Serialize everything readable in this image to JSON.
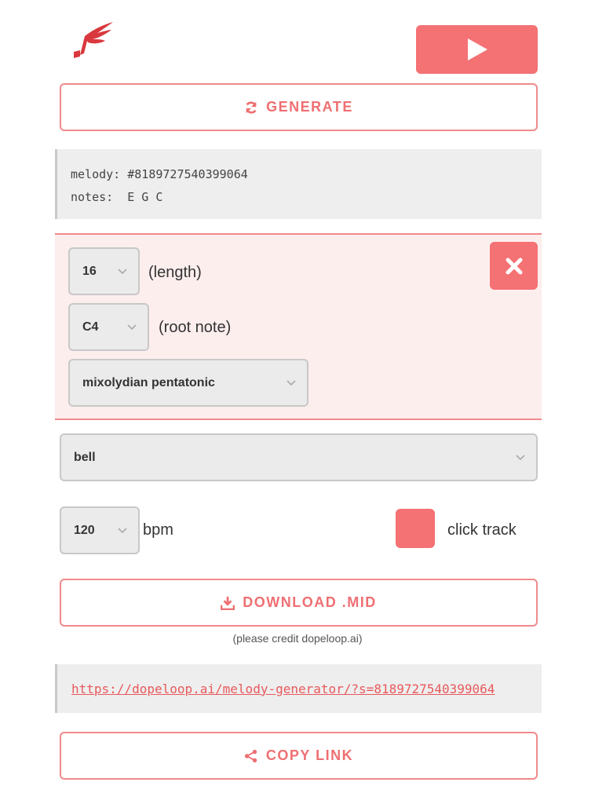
{
  "header": {
    "logo_icon": "winged-note-icon",
    "play_icon": "play-icon"
  },
  "actions": {
    "generate_label": "GENERATE",
    "download_label": "DOWNLOAD .MID",
    "copy_label": "COPY LINK",
    "credit_text": "(please credit dopeloop.ai)"
  },
  "melody_info": {
    "melody_line": "melody: #8189727540399064",
    "notes_line": "notes:  E G C"
  },
  "params": {
    "length_value": "16",
    "length_label": "(length)",
    "root_value": "C4",
    "root_label": "(root note)",
    "scale_value": "mixolydian pentatonic",
    "close_icon": "close-icon"
  },
  "instrument": {
    "value": "bell"
  },
  "tempo": {
    "bpm_value": "120",
    "bpm_label": "bpm",
    "click_label": "click track"
  },
  "share": {
    "url": "https://dopeloop.ai/melody-generator/?s=8189727540399064"
  },
  "colors": {
    "accent": "#f47174",
    "accent_text": "#ef6f72",
    "panel_bg": "#fdeeee",
    "code_bg": "#eeeeee"
  }
}
